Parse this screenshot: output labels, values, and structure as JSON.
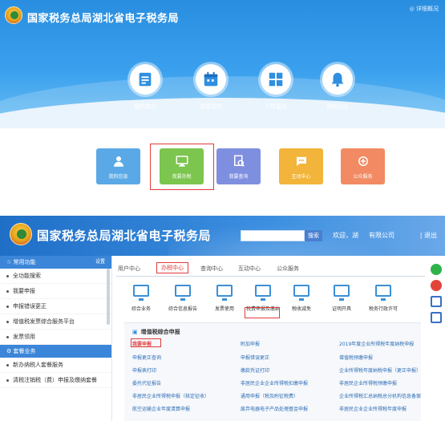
{
  "top": {
    "title": "国家税务总局湖北省电子税务局",
    "right_link": "◎ 详细概况",
    "tiles": [
      {
        "label": "我的待办",
        "icon": "calendar-list-icon"
      },
      {
        "label": "我要预约",
        "icon": "calendar-icon"
      },
      {
        "label": "个性服务",
        "icon": "grid-icon"
      },
      {
        "label": "通知公告",
        "icon": "bell-icon"
      }
    ]
  },
  "cards": [
    {
      "label": "我的信息",
      "icon": "user-icon",
      "color": "#5aa9e6"
    },
    {
      "label": "我要办税",
      "icon": "monitor-icon",
      "color": "#7cc54e"
    },
    {
      "label": "我要查询",
      "icon": "search-doc-icon",
      "color": "#7f8fe0"
    },
    {
      "label": "互动中心",
      "icon": "chat-icon",
      "color": "#f2b43a"
    },
    {
      "label": "公众服务",
      "icon": "service-icon",
      "color": "#f28a63"
    }
  ],
  "screen2": {
    "title": "国家税务总局湖北省电子税务局",
    "search_placeholder": "",
    "search_button": "搜索",
    "welcome": "欢迎，湖",
    "company": "有限公司",
    "logout": "| 退出",
    "sidebar": {
      "header": "常用功能",
      "settings": "设置",
      "items": [
        "全功能搜索",
        "我要申报",
        "申报错误更正",
        "增值税发票综合服务平台",
        "发票领用"
      ],
      "header2": "套餐业务",
      "items2": [
        "新办纳税人套餐服务",
        "清税注销税（费）申报及缴纳套餐"
      ]
    },
    "tabs": [
      "用户中心",
      "办税中心",
      "查询中心",
      "互动中心",
      "公众服务"
    ],
    "active_tab": "办税中心",
    "icon_items": [
      "综合业务",
      "综合信息报告",
      "发票使用",
      "税费申报及缴纳",
      "税收减免",
      "证明开具",
      "税务行政许可"
    ],
    "panel": {
      "title": "增值税综合申报",
      "col1": [
        "我要申报",
        "申报更正查询",
        "申报表打印",
        "委托代征报告",
        "非居民企业所得税申报（核定征收）",
        "航空运输企业年度清算申报"
      ],
      "col2": [
        "附加申报",
        "申报错误更正",
        "缴款凭证打印",
        "非居民企业企业所得税扣缴申报",
        "通用申报（税及附征税费）",
        "废弃电器电子产品处理基金申报"
      ],
      "col3": [
        "2019年度企业所得税年度纳税申报",
        "增值税预缴申报",
        "企业所得税年度纳税申报（更正申报）",
        "非居民企业所得税预缴申报",
        "企业所得税汇总纳税总分机构信息备案",
        "非居民企业企业所得税年度申报"
      ]
    }
  }
}
